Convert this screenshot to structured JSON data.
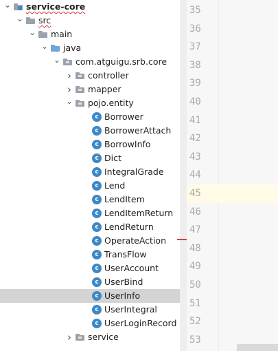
{
  "tree": {
    "nodes": [
      {
        "label": "service-core",
        "kind": "module",
        "depth": 0,
        "expanded": true,
        "bold": true,
        "squiggle": true
      },
      {
        "label": "src",
        "kind": "folder-gray",
        "depth": 1,
        "expanded": true,
        "squiggle": true
      },
      {
        "label": "main",
        "kind": "folder-gray",
        "depth": 2,
        "expanded": true
      },
      {
        "label": "java",
        "kind": "folder-blue",
        "depth": 3,
        "expanded": true
      },
      {
        "label": "com.atguigu.srb.core",
        "kind": "package",
        "depth": 4,
        "expanded": true
      },
      {
        "label": "controller",
        "kind": "package",
        "depth": 5,
        "expanded": false
      },
      {
        "label": "mapper",
        "kind": "package",
        "depth": 5,
        "expanded": false
      },
      {
        "label": "pojo.entity",
        "kind": "package",
        "depth": 5,
        "expanded": true
      },
      {
        "label": "Borrower",
        "kind": "class",
        "depth": 6
      },
      {
        "label": "BorrowerAttach",
        "kind": "class",
        "depth": 6
      },
      {
        "label": "BorrowInfo",
        "kind": "class",
        "depth": 6
      },
      {
        "label": "Dict",
        "kind": "class",
        "depth": 6
      },
      {
        "label": "IntegralGrade",
        "kind": "class",
        "depth": 6
      },
      {
        "label": "Lend",
        "kind": "class",
        "depth": 6
      },
      {
        "label": "LendItem",
        "kind": "class",
        "depth": 6
      },
      {
        "label": "LendItemReturn",
        "kind": "class",
        "depth": 6
      },
      {
        "label": "LendReturn",
        "kind": "class",
        "depth": 6
      },
      {
        "label": "OperateAction",
        "kind": "class",
        "depth": 6
      },
      {
        "label": "TransFlow",
        "kind": "class",
        "depth": 6
      },
      {
        "label": "UserAccount",
        "kind": "class",
        "depth": 6
      },
      {
        "label": "UserBind",
        "kind": "class",
        "depth": 6
      },
      {
        "label": "UserInfo",
        "kind": "class",
        "depth": 6,
        "selected": true
      },
      {
        "label": "UserIntegral",
        "kind": "class",
        "depth": 6
      },
      {
        "label": "UserLoginRecord",
        "kind": "class",
        "depth": 6
      },
      {
        "label": "service",
        "kind": "package",
        "depth": 5,
        "expanded": false
      }
    ],
    "class_icon_letter": "c"
  },
  "editor": {
    "line_numbers": [
      "35",
      "36",
      "37",
      "38",
      "39",
      "40",
      "41",
      "42",
      "43",
      "44",
      "45",
      "46",
      "47",
      "48",
      "49",
      "50",
      "51",
      "52",
      "53"
    ],
    "current_line": "45"
  },
  "colors": {
    "selection": "#d4d4d4",
    "class_icon": "#3d88c6",
    "folder_gray": "#9aa3ac",
    "folder_blue": "#6fa4d8",
    "line_number": "#a9a9a9",
    "current_line_bg": "#fffbe6"
  }
}
